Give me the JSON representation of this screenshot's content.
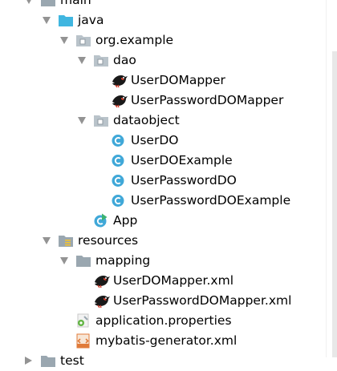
{
  "tree": {
    "items": [
      {
        "label": "main",
        "indent": 0,
        "expanded": true,
        "kind": "folder-gray",
        "icon": "folder-icon"
      },
      {
        "label": "java",
        "indent": 1,
        "expanded": true,
        "kind": "folder-blue",
        "icon": "source-folder-icon"
      },
      {
        "label": "org.example",
        "indent": 2,
        "expanded": true,
        "kind": "package",
        "icon": "package-icon"
      },
      {
        "label": "dao",
        "indent": 3,
        "expanded": true,
        "kind": "package",
        "icon": "package-icon"
      },
      {
        "label": "UserDOMapper",
        "indent": 4,
        "kind": "mybatis",
        "icon": "mybatis-bird-icon"
      },
      {
        "label": "UserPasswordDOMapper",
        "indent": 4,
        "kind": "mybatis",
        "icon": "mybatis-bird-icon"
      },
      {
        "label": "dataobject",
        "indent": 3,
        "expanded": true,
        "kind": "package",
        "icon": "package-icon"
      },
      {
        "label": "UserDO",
        "indent": 4,
        "kind": "class",
        "icon": "class-c-icon"
      },
      {
        "label": "UserDOExample",
        "indent": 4,
        "kind": "class",
        "icon": "class-c-icon"
      },
      {
        "label": "UserPasswordDO",
        "indent": 4,
        "kind": "class",
        "icon": "class-c-icon"
      },
      {
        "label": "UserPasswordDOExample",
        "indent": 4,
        "kind": "class",
        "icon": "class-c-icon"
      },
      {
        "label": "App",
        "indent": 3,
        "kind": "app",
        "icon": "app-class-icon"
      },
      {
        "label": "resources",
        "indent": 1,
        "expanded": true,
        "kind": "resources",
        "icon": "resources-folder-icon"
      },
      {
        "label": "mapping",
        "indent": 2,
        "expanded": true,
        "kind": "folder-gray",
        "icon": "folder-icon"
      },
      {
        "label": "UserDOMapper.xml",
        "indent": 3,
        "kind": "mybatis",
        "icon": "mybatis-bird-icon"
      },
      {
        "label": "UserPasswordDOMapper.xml",
        "indent": 3,
        "kind": "mybatis",
        "icon": "mybatis-bird-icon"
      },
      {
        "label": "application.properties",
        "indent": 2,
        "kind": "properties",
        "icon": "properties-file-icon"
      },
      {
        "label": "mybatis-generator.xml",
        "indent": 2,
        "kind": "xml",
        "icon": "xml-file-icon"
      },
      {
        "label": "test",
        "indent": 0,
        "expanded": false,
        "kind": "folder-gray",
        "icon": "folder-icon"
      }
    ]
  },
  "colors": {
    "folder_gray": "#9aa7b0",
    "folder_blue": "#40b6e0",
    "class_blue": "#40a8d8",
    "arrow_gray": "#939393",
    "xml_orange": "#e07b3a"
  }
}
